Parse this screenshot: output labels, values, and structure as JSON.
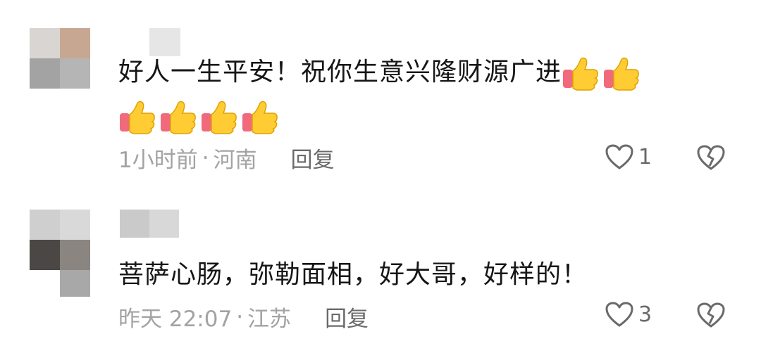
{
  "comments": [
    {
      "text": "好人一生平安！祝你生意兴隆财源广进",
      "emoji_icon": "thumbs-up-icon",
      "emoji_count": 6,
      "time": "1小时前",
      "location": "河南",
      "reply_label": "回复",
      "like_count": "1",
      "avatar_colors": [
        "#d9d5d2",
        "#c7a792",
        "#a3a3a3",
        "#b5b5b5"
      ],
      "nick_colors": [
        "#e2e2e2"
      ]
    },
    {
      "text": "菩萨心肠，弥勒面相，好大哥，好样的！",
      "time": "昨天 22:07",
      "location": "江苏",
      "reply_label": "回复",
      "like_count": "3",
      "avatar_colors": [
        "#cfcfcf",
        "#d9d9d9",
        "#4b4744",
        "#8a8580"
      ],
      "nick_colors": [
        "#cacaca",
        "#d8d8d8"
      ]
    }
  ],
  "icons": {
    "like": "heart-outline-icon",
    "dislike": "broken-heart-icon"
  },
  "colors": {
    "meta_text": "#a3a3a3",
    "reply_text": "#6a6a6a",
    "main_text": "#161616",
    "thumb_yellow": "#ffcc33",
    "thumb_cuff": "#f06a7c"
  }
}
